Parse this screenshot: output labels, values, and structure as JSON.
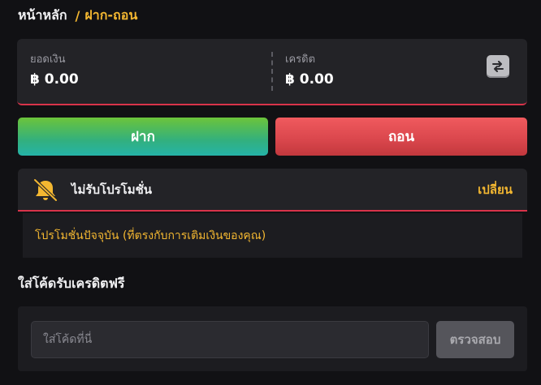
{
  "breadcrumb": {
    "home": "หน้าหลัก",
    "separator": "/",
    "current": "ฝาก-ถอน"
  },
  "balance": {
    "balance_label": "ยอดเงิน",
    "balance_value": "฿ 0.00",
    "credit_label": "เครดิต",
    "credit_value": "฿ 0.00",
    "swap_icon": "swap-arrows-icon"
  },
  "actions": {
    "deposit_label": "ฝาก",
    "withdraw_label": "ถอน"
  },
  "promotion": {
    "icon": "bell-off-icon",
    "status_label": "ไม่รับโปรโมชั่น",
    "change_label": "เปลี่ยน",
    "current_text": "โปรโมชั่นปัจจุบัน (ที่ตรงกับการเติมเงินของคุณ)"
  },
  "free_credit": {
    "title": "ใส่โค้ดรับเครดิตฟรี",
    "input_placeholder": "ใส่โค้ดที่นี่",
    "input_value": "",
    "check_label": "ตรวจสอบ"
  },
  "colors": {
    "accent_gold": "#f3b731",
    "alert_red": "#d8334a",
    "deposit_green": "#32b07e",
    "withdraw_red": "#d9464c"
  }
}
